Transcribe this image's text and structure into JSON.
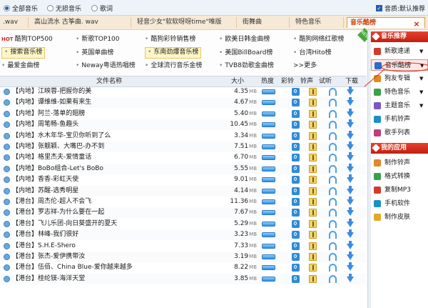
{
  "topbar": {
    "options": [
      {
        "label": "全部音乐",
        "selected": true
      },
      {
        "label": "无损音乐",
        "selected": false
      },
      {
        "label": "歌词",
        "selected": false
      }
    ],
    "sound_label": "音质:默认推荐"
  },
  "tabs": [
    {
      "label": ".wav"
    },
    {
      "label": "高山流水 古筝曲. wav"
    },
    {
      "label": "轻音少女\"软软呀呀time\"唯版"
    },
    {
      "label": "街舞曲"
    },
    {
      "label": "特色音乐"
    },
    {
      "label": "音乐酷榜",
      "active": true
    }
  ],
  "categories": [
    {
      "label": "酷狗TOP500",
      "hot": true
    },
    {
      "label": "新歌TOP100"
    },
    {
      "label": "酷狗彩铃销售榜"
    },
    {
      "label": "欧美日韩金曲榜"
    },
    {
      "label": "酷狗网络红歌榜"
    },
    {
      "label": "搜索音乐榜",
      "highlight": true
    },
    {
      "label": "英国单曲榜"
    },
    {
      "label": "东南劲爆音乐榜",
      "highlight": true
    },
    {
      "label": "美国BillBoard榜"
    },
    {
      "label": "台湾Hito榜"
    },
    {
      "label": "最爱金曲榜"
    },
    {
      "label": "Neway粤语热唱榜"
    },
    {
      "label": "全球流行音乐金榜"
    },
    {
      "label": "TVB8劲歌金曲榜"
    },
    {
      "label": "更多",
      "prefix": ">>"
    }
  ],
  "new_badge": "NEW",
  "table": {
    "headers": {
      "name": "文件名称",
      "size": "大小",
      "heat": "热度",
      "ring": "彩铃",
      "bell": "铃声",
      "listen": "试听",
      "download": "下载"
    },
    "size_unit": "MB",
    "rows": [
      {
        "title": "【内地】江映蓉-把握你的美",
        "size": "4.35"
      },
      {
        "title": "【内地】谭维维-如果有来生",
        "size": "4.67"
      },
      {
        "title": "【内地】阿兰-落单的翅膀",
        "size": "5.40"
      },
      {
        "title": "【内地】周笔畅-鱼趣头",
        "size": "10.45"
      },
      {
        "title": "【内地】水木年华-宝贝你听到了么",
        "size": "3.34"
      },
      {
        "title": "【内地】张靓颖、大嘴巴-办不到",
        "size": "7.51"
      },
      {
        "title": "【内地】格里杰夫-爱情童话",
        "size": "6.70"
      },
      {
        "title": "【内地】BoBo组合-Let's BoBo",
        "size": "5.55"
      },
      {
        "title": "【内地】香香-彩虹天使",
        "size": "9.01"
      },
      {
        "title": "【内地】苏醒-选秀明星",
        "size": "4.14"
      },
      {
        "title": "【港台】周杰伦-超人不会飞",
        "size": "11.36"
      },
      {
        "title": "【港台】罗志祥-为什么要在一起",
        "size": "7.67"
      },
      {
        "title": "【港台】飞儿乐团-向日葵盛开的夏天",
        "size": "5.29"
      },
      {
        "title": "【港台】林峰-我们很好",
        "size": "3.23"
      },
      {
        "title": "【港台】S.H.E-Shero",
        "size": "7.33"
      },
      {
        "title": "【港台】张杰-爱伊携带汝",
        "size": "3.19"
      },
      {
        "title": "【港台】伍佰、China Blue-爱你越来越多",
        "size": "8.22"
      },
      {
        "title": "【港台】桂纶镁-海洋天堂",
        "size": "3.85"
      }
    ]
  },
  "sidebar": {
    "section1_title": "音乐推荐",
    "section1_items": [
      {
        "label": "新歌速递",
        "color": "#d23a2a",
        "arrow": true
      },
      {
        "label": "音乐酷榜",
        "color": "#2a6cc7",
        "arrow": true,
        "selected": true
      },
      {
        "label": "狗友专辑",
        "color": "#e08a1c",
        "arrow": true
      },
      {
        "label": "特色音乐",
        "color": "#3aa04a",
        "arrow": true
      },
      {
        "label": "主题音乐",
        "color": "#7e55c4",
        "arrow": true
      },
      {
        "label": "手机铃声",
        "color": "#1d8fc8"
      },
      {
        "label": "歌手列表",
        "color": "#c23d78"
      }
    ],
    "section2_title": "我的应用",
    "section2_items": [
      {
        "label": "制作铃声",
        "color": "#e0882a"
      },
      {
        "label": "格式转换",
        "color": "#3aa04a"
      },
      {
        "label": "复制MP3",
        "color": "#d23a2a"
      },
      {
        "label": "手机软件",
        "color": "#1d8fc8"
      },
      {
        "label": "制作皮肤",
        "color": "#e0a92a"
      }
    ]
  }
}
